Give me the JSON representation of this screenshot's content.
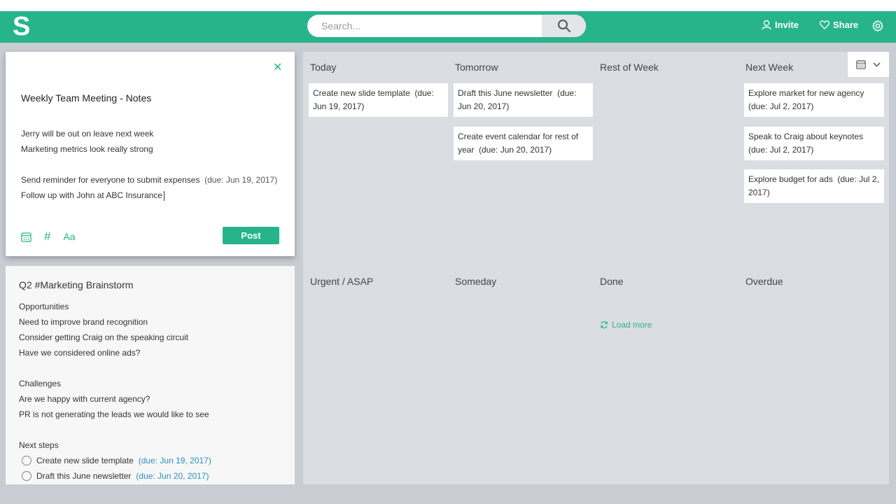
{
  "header": {
    "logo_letter": "S",
    "search_placeholder": "Search...",
    "invite_label": "Invite",
    "share_label": "Share"
  },
  "editor": {
    "title": "Weekly Team Meeting - Notes",
    "lines": [
      {
        "text": "Jerry will be out on leave next week",
        "due": ""
      },
      {
        "text": "Marketing metrics look really strong",
        "due": ""
      },
      {
        "text": "",
        "due": ""
      },
      {
        "text": "Send reminder for everyone to submit expenses",
        "due": "(due: Jun 19, 2017)"
      },
      {
        "text": "Follow up with John at ABC Insurance",
        "due": ""
      }
    ],
    "format_label": "Aa",
    "post_label": "Post"
  },
  "note_card": {
    "title": "Q2 #Marketing Brainstorm",
    "lines": [
      "Opportunities",
      "Need to improve brand recognition",
      "Consider getting Craig on the speaking circuit",
      "Have we considered online ads?",
      "",
      "Challenges",
      "Are we happy with current agency?",
      "PR is not generating the leads we would like to see",
      "",
      "Next steps"
    ],
    "todos": [
      {
        "text": "Create new slide template",
        "due": "(due: Jun 19, 2017)"
      },
      {
        "text": "Draft this June newsletter",
        "due": "(due: Jun 20, 2017)"
      }
    ]
  },
  "board": {
    "columns": [
      {
        "title": "Today",
        "cards": [
          {
            "text": "Create new slide template",
            "due": "(due: Jun 19, 2017)"
          }
        ]
      },
      {
        "title": "Tomorrow",
        "cards": [
          {
            "text": "Draft this June newsletter",
            "due": "(due: Jun 20, 2017)"
          },
          {
            "text": "Create event calendar for rest of year",
            "due": "(due: Jun 20, 2017)"
          }
        ]
      },
      {
        "title": "Rest of Week",
        "cards": []
      },
      {
        "title": "Next Week",
        "cards": [
          {
            "text": "Explore market for new agency",
            "due": "(due: Jul 2, 2017)"
          },
          {
            "text": "Speak to Craig about keynotes",
            "due": "(due: Jul 2, 2017)"
          },
          {
            "text": "Explore budget for ads",
            "due": "(due: Jul 2, 2017)"
          }
        ]
      },
      {
        "title": "Urgent / ASAP",
        "cards": []
      },
      {
        "title": "Someday",
        "cards": []
      },
      {
        "title": "Done",
        "cards": []
      },
      {
        "title": "Overdue",
        "cards": []
      }
    ],
    "load_more_label": "Load more"
  },
  "colors": {
    "accent": "#27b48c",
    "board_bg": "#dadde2",
    "due_link": "#2a8fc4"
  }
}
